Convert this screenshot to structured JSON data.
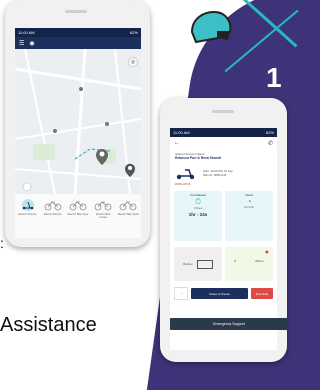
{
  "decor": {
    "step_number": "1",
    "side_colon": ":",
    "assistance_text": "Assistance"
  },
  "phone_map": {
    "status_time": "11:00 AM",
    "status_right": "62%",
    "app_title": "",
    "vehicles": [
      {
        "label": "Electric Scooter"
      },
      {
        "label": "Electric Bicycle"
      },
      {
        "label": "Electric Bike Type"
      },
      {
        "label": "Electric Bike Cruiser"
      },
      {
        "label": "Electric Bike Sport"
      }
    ]
  },
  "phone_ride": {
    "status_time": "11:00 AM",
    "status_right": "62%",
    "user_label": "Shared Scooter Name",
    "user_name": "Rebecca Puri & Reza Shandi",
    "start_label": "Start: 10:00 PM, 16 Sep",
    "ride_label": "Ride ID: 98601245",
    "ride_id": "#ZWS-18726",
    "time_card_title": "Time Elapsed",
    "time_card_value": "0 Days",
    "time_card_value2": "1hr - 24s",
    "speed_card_title": "Speed",
    "speed_card_value": "10 km/hr",
    "battery_label": "Battery",
    "dist_vals": [
      "0",
      "20 km"
    ],
    "pause_label": "Swipe to Pause",
    "end_label": "End Ride",
    "emergency_label": "Emergency Support"
  },
  "colors": {
    "navy": "#1d2f5c",
    "purple": "#3d3378",
    "teal": "#27b8c6",
    "red": "#e04848"
  }
}
